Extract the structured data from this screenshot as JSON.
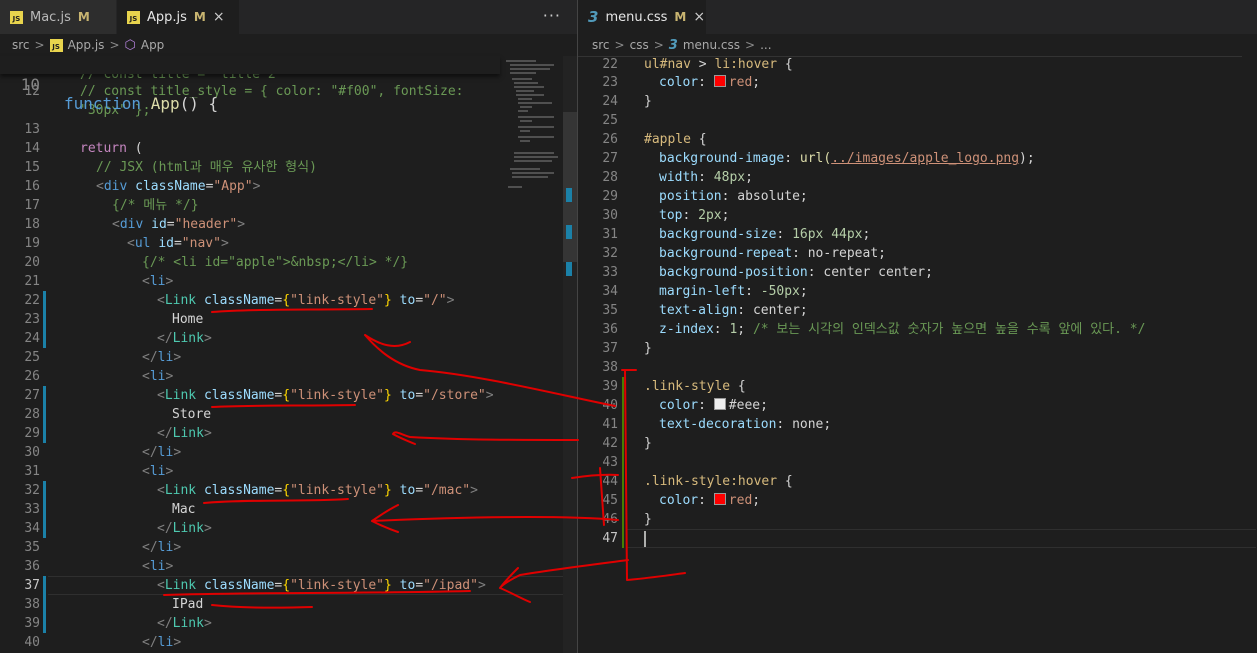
{
  "left_tabs": [
    {
      "label": "Mac.js",
      "modified": "M",
      "icon": "js-file-icon"
    },
    {
      "label": "App.js",
      "modified": "M",
      "icon": "js-file-icon",
      "close": "×"
    }
  ],
  "more_actions": "···",
  "right_tab": {
    "label": "menu.css",
    "modified": "M",
    "icon": "css-file-icon",
    "close": "×"
  },
  "left_breadcrumb": {
    "folder": "src",
    "file": "App.js",
    "symbol": "App"
  },
  "right_breadcrumb": {
    "folder": "src",
    "sub": "css",
    "file": "menu.css",
    "more": "..."
  },
  "sep": ">",
  "js_badge": "JS",
  "cube": "⬡",
  "css_glyph": "3",
  "colors": {
    "red": "#ff0000",
    "eee": "#eeeeee",
    "accent": "#1b81a8"
  },
  "left_code": {
    "l10": {
      "num": "10",
      "k": "function",
      "name": "App",
      "rest": "() {"
    },
    "l11": {
      "num": "",
      "text": "// const title = 'title 2'"
    },
    "l12": {
      "num": "12",
      "text": "// const title_style = { color: \"#f00\", fontSize:"
    },
    "l12b": {
      "text": "\"30px\" };"
    },
    "l13": {
      "num": "13"
    },
    "l14": {
      "num": "14",
      "k": "return",
      "rest": " ("
    },
    "l15": {
      "num": "15",
      "text": "// JSX (html과 매우 유사한 형식)"
    },
    "l16": {
      "num": "16",
      "tag": "div",
      "attr": "className",
      "val": "\"App\""
    },
    "l17": {
      "num": "17",
      "text": "{/* 메뉴 */}"
    },
    "l18": {
      "num": "18",
      "tag": "div",
      "attr": "id",
      "val": "\"header\""
    },
    "l19": {
      "num": "19",
      "tag": "ul",
      "attr": "id",
      "val": "\"nav\""
    },
    "l20": {
      "num": "20",
      "text": "{/* <li id=\"apple\">&nbsp;</li> */}"
    },
    "l21": {
      "num": "21",
      "tag": "li"
    },
    "l22": {
      "num": "22",
      "tag": "Link",
      "attr": "className",
      "val": "\"link-style\"",
      "to": "\"/\""
    },
    "l23": {
      "num": "23",
      "text": "Home"
    },
    "l24": {
      "num": "24",
      "tag": "Link"
    },
    "l25": {
      "num": "25",
      "tag": "li"
    },
    "l26": {
      "num": "26",
      "tag": "li"
    },
    "l27": {
      "num": "27",
      "tag": "Link",
      "attr": "className",
      "val": "\"link-style\"",
      "to": "\"/store\""
    },
    "l28": {
      "num": "28",
      "text": "Store"
    },
    "l29": {
      "num": "29",
      "tag": "Link"
    },
    "l30": {
      "num": "30",
      "tag": "li"
    },
    "l31": {
      "num": "31",
      "tag": "li"
    },
    "l32": {
      "num": "32",
      "tag": "Link",
      "attr": "className",
      "val": "\"link-style\"",
      "to": "\"/mac\""
    },
    "l33": {
      "num": "33",
      "text": "Mac"
    },
    "l34": {
      "num": "34",
      "tag": "Link"
    },
    "l35": {
      "num": "35",
      "tag": "li"
    },
    "l36": {
      "num": "36",
      "tag": "li"
    },
    "l37": {
      "num": "37",
      "tag": "Link",
      "attr": "className",
      "val": "\"link-style\"",
      "to": "\"/ipad\""
    },
    "l38": {
      "num": "38",
      "text": "IPad"
    },
    "l39": {
      "num": "39",
      "tag": "Link"
    },
    "l40": {
      "num": "40",
      "tag": "li"
    }
  },
  "right_code": {
    "r22": {
      "num": "22",
      "sel1": "ul",
      "id": "#nav",
      "op": " > ",
      "sel2": "li",
      "pseudo": ":hover",
      "rest": " {"
    },
    "r23": {
      "num": "23",
      "prop": "color",
      "val": "red"
    },
    "r24": {
      "num": "24",
      "text": "}"
    },
    "r25": {
      "num": "25"
    },
    "r26": {
      "num": "26",
      "sel": "#apple",
      "rest": " {"
    },
    "r27": {
      "num": "27",
      "prop": "background-image",
      "fn": "url(",
      "url": "../images/apple_logo.png",
      "end": ");"
    },
    "r28": {
      "num": "28",
      "prop": "width",
      "val": "48px"
    },
    "r29": {
      "num": "29",
      "prop": "position",
      "val": "absolute"
    },
    "r30": {
      "num": "30",
      "prop": "top",
      "val": "2px"
    },
    "r31": {
      "num": "31",
      "prop": "background-size",
      "val": "16px 44px"
    },
    "r32": {
      "num": "32",
      "prop": "background-repeat",
      "val": "no-repeat"
    },
    "r33": {
      "num": "33",
      "prop": "background-position",
      "val": "center center"
    },
    "r34": {
      "num": "34",
      "prop": "margin-left",
      "val": "-50px"
    },
    "r35": {
      "num": "35",
      "prop": "text-align",
      "val": "center"
    },
    "r36": {
      "num": "36",
      "prop": "z-index",
      "val": "1",
      "comment": "/* 보는 시각의 인덱스값 숫자가 높으면 높을 수록 앞에 있다. */"
    },
    "r37": {
      "num": "37",
      "text": "}"
    },
    "r38": {
      "num": "38"
    },
    "r39": {
      "num": "39",
      "sel": ".link-style",
      "rest": " {"
    },
    "r40": {
      "num": "40",
      "prop": "color",
      "val": "#eee"
    },
    "r41": {
      "num": "41",
      "prop": "text-decoration",
      "val": "none"
    },
    "r42": {
      "num": "42",
      "text": "}"
    },
    "r43": {
      "num": "43"
    },
    "r44": {
      "num": "44",
      "sel": ".link-style:hover",
      "rest": " {"
    },
    "r45": {
      "num": "45",
      "prop": "color",
      "val": "red"
    },
    "r46": {
      "num": "46",
      "text": "}"
    },
    "r47": {
      "num": "47"
    }
  }
}
